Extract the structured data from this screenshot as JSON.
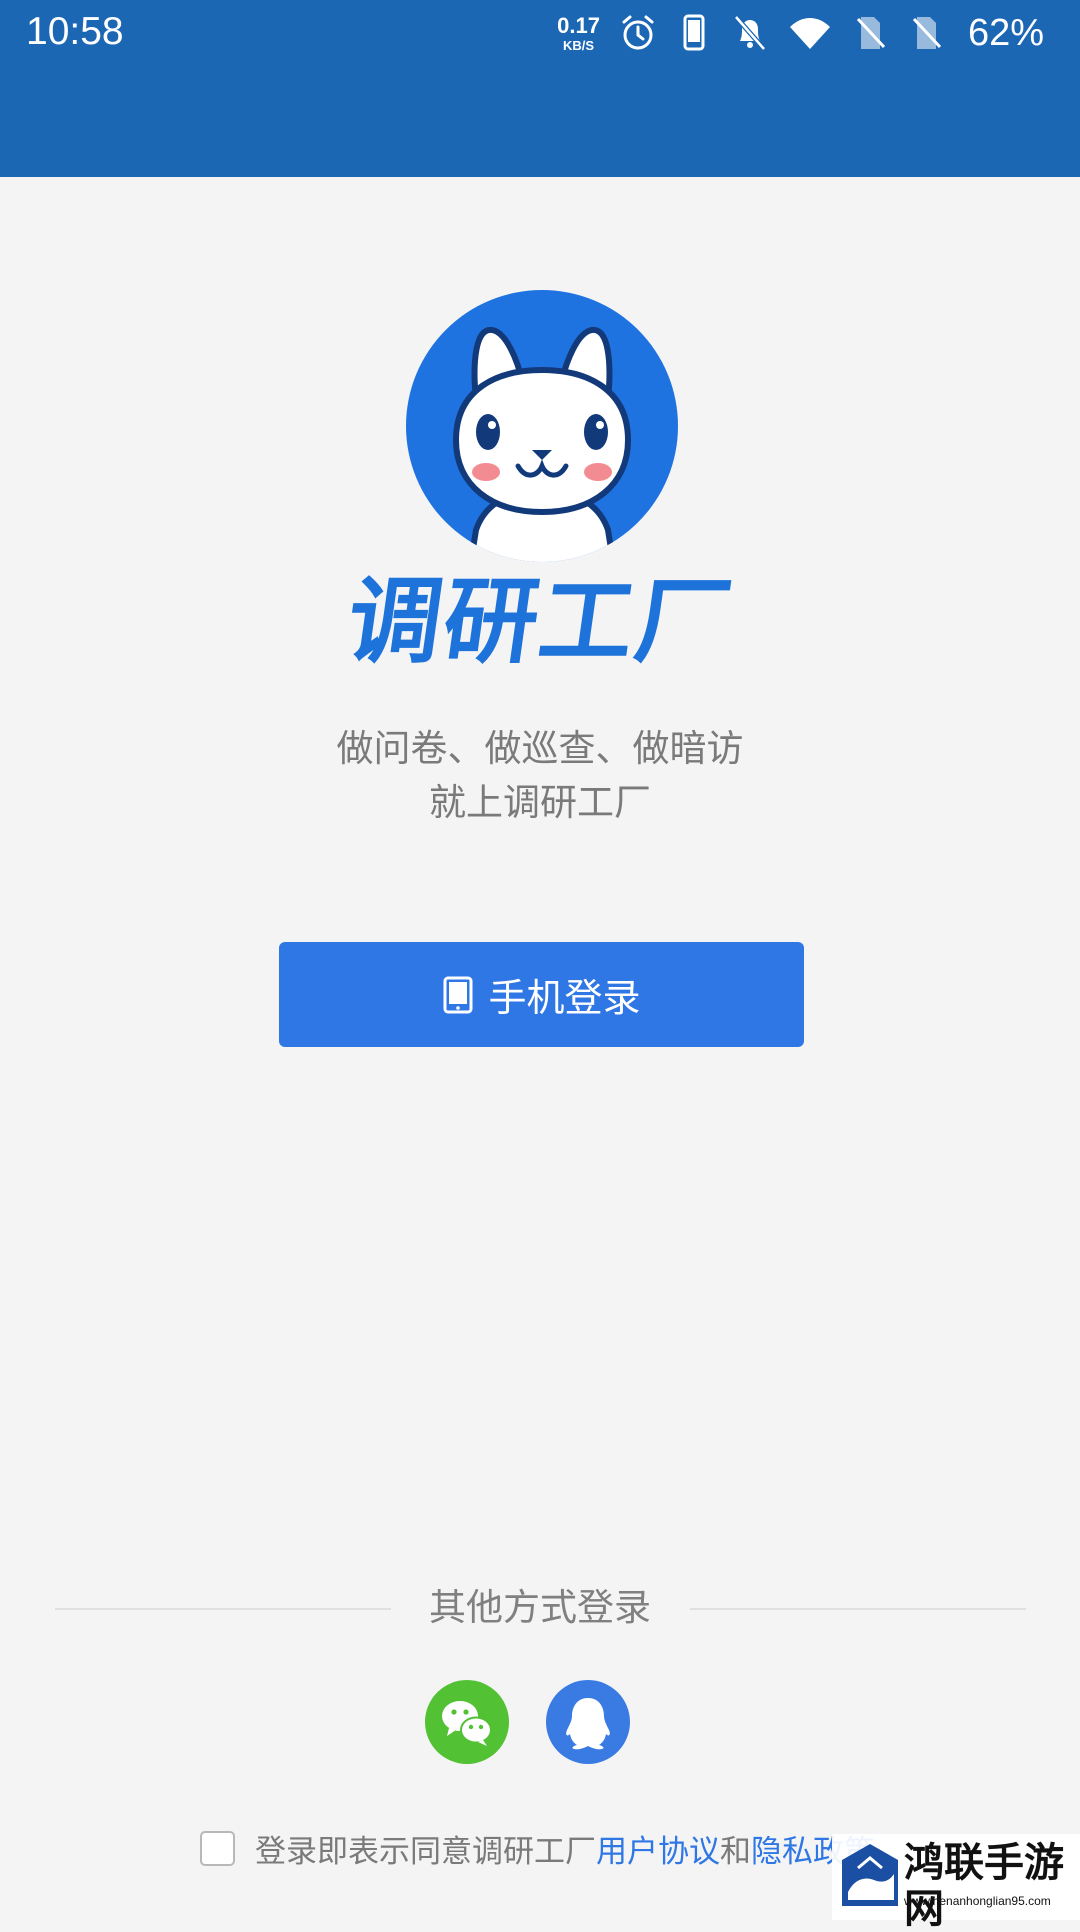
{
  "status_bar": {
    "time": "10:58",
    "net_speed_value": "0.17",
    "net_speed_unit": "KB/S",
    "battery": "62%",
    "icons": [
      "alarm-icon",
      "phone-icon",
      "bell-off-icon",
      "wifi-icon",
      "no-sim-icon",
      "no-sim-icon"
    ]
  },
  "brand": {
    "name": "调研工厂",
    "logo": "rabbit-logo-icon",
    "color": "#1d73d9"
  },
  "tagline": {
    "line1": "做问卷、做巡查、做暗访",
    "line2": "就上调研工厂"
  },
  "login": {
    "phone_button_label": "手机登录",
    "phone_button_icon": "tablet-icon",
    "button_color": "#2f77e4"
  },
  "other_login": {
    "label": "其他方式登录",
    "options": [
      {
        "name": "wechat",
        "icon": "wechat-icon",
        "color": "#53c134"
      },
      {
        "name": "qq",
        "icon": "qq-icon",
        "color": "#3a7ae3"
      }
    ]
  },
  "agreement": {
    "prefix": "登录即表示同意调研工厂",
    "user_agreement": "用户协议",
    "conjunction": "和",
    "privacy_policy": "隐私政策",
    "checked": false
  },
  "watermark": {
    "title": "鸿联手游网",
    "url": "www.henanhonglian95.com"
  },
  "colors": {
    "header": "#1c67b4",
    "background": "#f4f4f5",
    "link": "#2f77e4"
  }
}
